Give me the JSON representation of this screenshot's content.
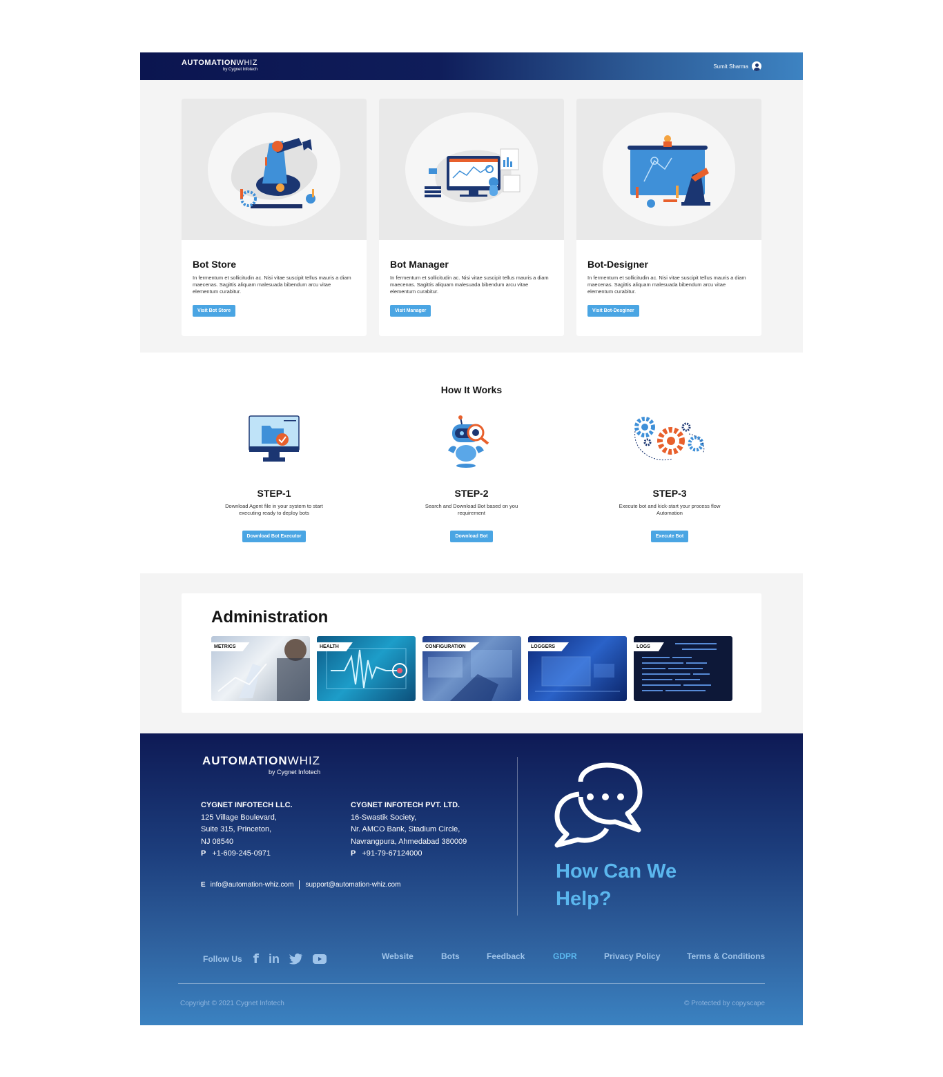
{
  "header": {
    "logo_bold": "AUTOMATION",
    "logo_light": "WHIZ",
    "logo_by": "by Cygnet Infotech",
    "user_name": "Sumit Sharma"
  },
  "cards": [
    {
      "title": "Bot Store",
      "text": "In fermentum et sollicitudin ac. Nisi vitae suscipit tellus mauris a diam maecenas. Sagittis aliquam malesuada bibendum arcu vitae elementum curabitur.",
      "button": "Visit Bot Store"
    },
    {
      "title": "Bot Manager",
      "text": "In fermentum et sollicitudin ac. Nisi vitae suscipit tellus mauris a diam maecenas. Sagittis aliquam malesuada bibendum arcu vitae elementum curabitur.",
      "button": "Visit Manager"
    },
    {
      "title": "Bot-Designer",
      "text": "In fermentum et sollicitudin ac. Nisi vitae suscipit tellus mauris a diam maecenas. Sagittis aliquam malesuada bibendum arcu vitae elementum curabitur.",
      "button": "Visit Bot-Desginer"
    }
  ],
  "how": {
    "title": "How It Works",
    "steps": [
      {
        "title": "STEP-1",
        "text": "Download Agent file in your system to start executing ready to deploy bots",
        "button": "Download Bot Executor"
      },
      {
        "title": "STEP-2",
        "text": "Search and Download Bot based on you requirement",
        "button": "Download Bot"
      },
      {
        "title": "STEP-3",
        "text": "Execute bot and kick-start your process flow Automation",
        "button": "Execute Bot"
      }
    ]
  },
  "admin": {
    "title": "Administration",
    "tiles": [
      "METRICS",
      "HEALTH",
      "CONFIGURATION",
      "LOGGERS",
      "LOGS"
    ]
  },
  "footer": {
    "logo_bold": "AUTOMATION",
    "logo_light": "WHIZ",
    "logo_by": "by Cygnet Infotech",
    "office1": {
      "title": "CYGNET INFOTECH LLC.",
      "line1": "125 Village Boulevard,",
      "line2": "Suite 315, Princeton,",
      "line3": "NJ 08540",
      "phone_label": "P",
      "phone": "+1-609-245-0971"
    },
    "office2": {
      "title": "CYGNET INFOTECH PVT. LTD.",
      "line1": "16-Swastik Society,",
      "line2": "Nr. AMCO Bank, Stadium Circle,",
      "line3": "Navrangpura, Ahmedabad 380009",
      "phone_label": "P",
      "phone": "+91-79-67124000"
    },
    "email_label": "E",
    "email1": "info@automation-whiz.com",
    "email2": "support@automation-whiz.com",
    "help_line1": "How Can We",
    "help_line2": "Help?",
    "follow": "Follow Us",
    "social": [
      "facebook-icon",
      "linkedin-icon",
      "twitter-icon",
      "youtube-icon"
    ],
    "links": [
      "Website",
      "Bots",
      "Feedback",
      "GDPR",
      "Privacy Policy",
      "Terms & Conditions"
    ],
    "copyright": "Copyright © 2021 Cygnet Infotech",
    "protected": "© Protected by copyscape"
  },
  "colors": {
    "accent": "#4aa5e3",
    "navy": "#0b1550",
    "help": "#5bb7ee",
    "orange": "#e8602c"
  }
}
